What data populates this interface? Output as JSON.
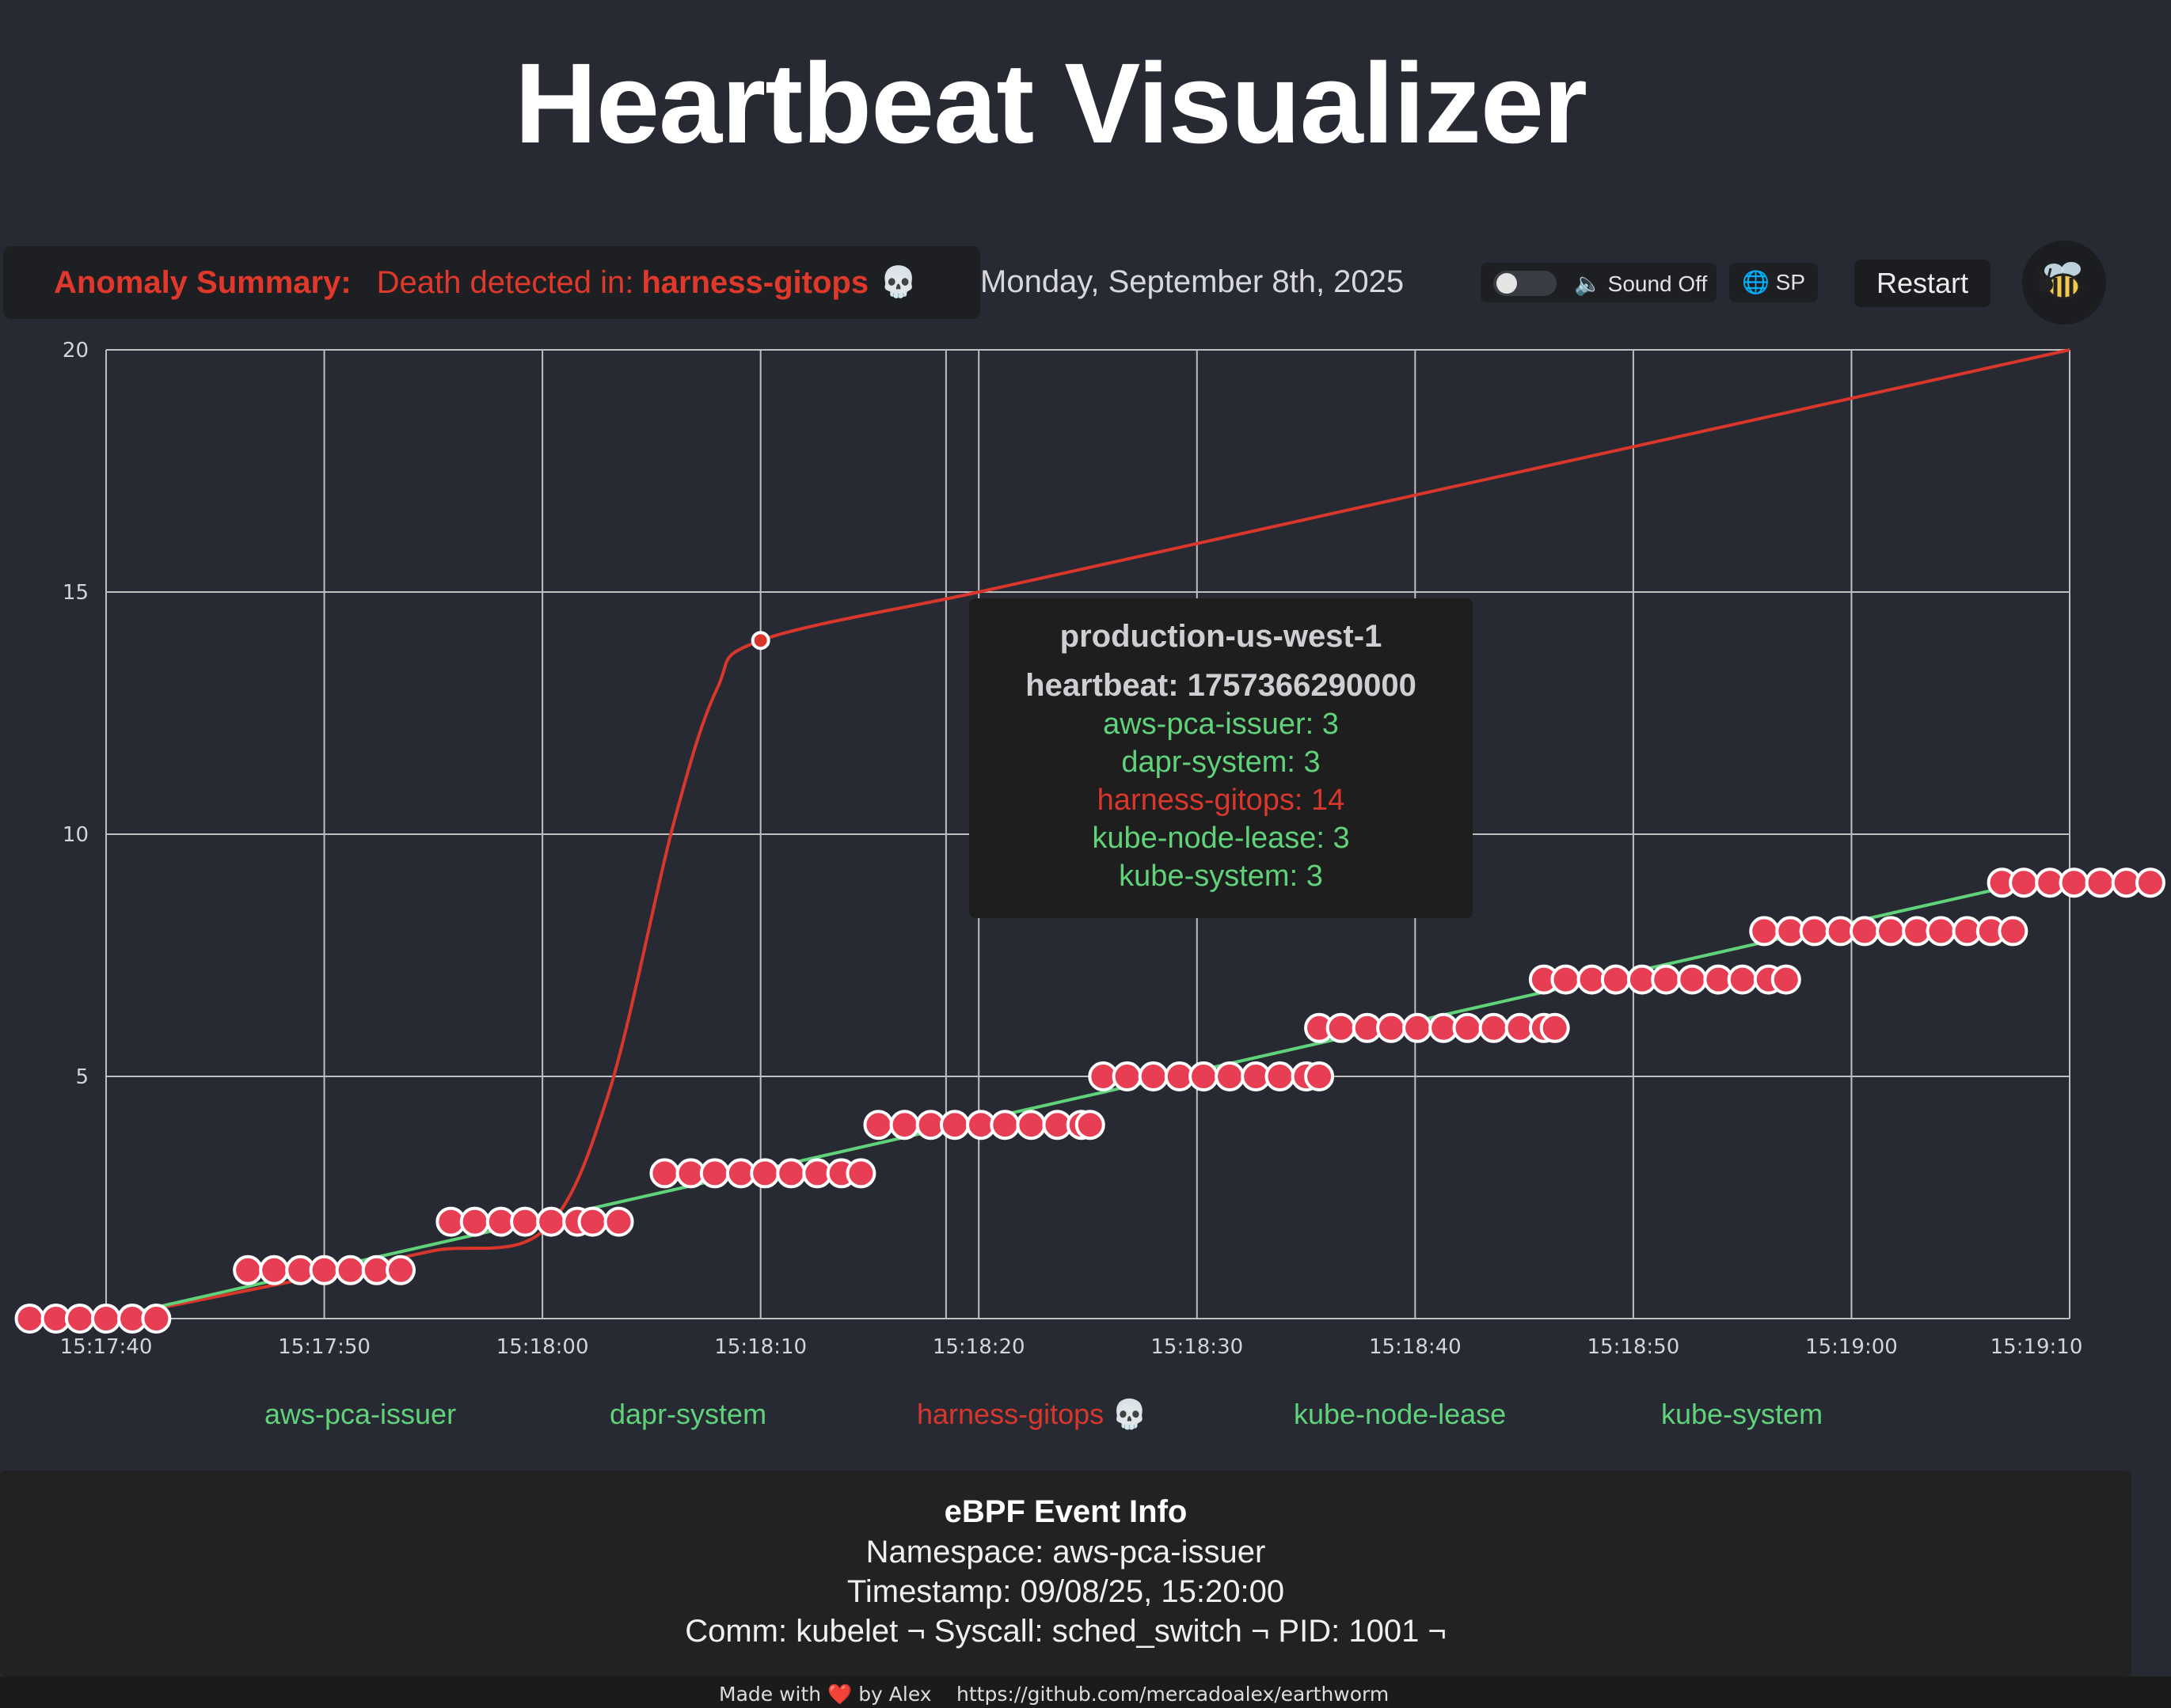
{
  "header": {
    "title": "Heartbeat Visualizer"
  },
  "anomaly": {
    "label": "Anomaly Summary:",
    "message": "Death detected in:",
    "namespace": "harness-gitops",
    "icon": "skull-icon",
    "skull_glyph": "💀"
  },
  "date": "Monday, September 8th, 2025",
  "controls": {
    "sound_label": "🔈 Sound Off",
    "sound_on": false,
    "language_label": "🌐 SP",
    "restart_label": "Restart",
    "mascot_icon": "bee-icon"
  },
  "colors": {
    "healthy": "#5fd27a",
    "dead": "#d9372c",
    "point_fill": "#e83e53",
    "grid": "#bfbfbf"
  },
  "chart_data": {
    "type": "line",
    "x_ticks": [
      "15:17:40",
      "15:17:50",
      "15:18:00",
      "15:18:10",
      "15:18:20",
      "15:18:30",
      "15:18:40",
      "15:18:50",
      "15:19:00",
      "15:19:10"
    ],
    "y_ticks": [
      "20",
      "15",
      "10",
      "5"
    ],
    "ylim": [
      0,
      20
    ],
    "grid": true,
    "series": [
      {
        "name": "harness-gitops",
        "status": "dead",
        "points": [
          [
            "15:17:40",
            0
          ],
          [
            "15:17:50",
            0.9
          ],
          [
            "15:17:55",
            1.4
          ],
          [
            "15:18:00",
            1.8
          ],
          [
            "15:18:03",
            4.6
          ],
          [
            "15:18:06",
            10.2
          ],
          [
            "15:18:08",
            13.0
          ],
          [
            "15:18:10",
            14.0
          ],
          [
            "15:18:20",
            15.0
          ],
          [
            "15:18:30",
            16.0
          ],
          [
            "15:18:40",
            17.0
          ],
          [
            "15:18:50",
            18.0
          ],
          [
            "15:19:00",
            19.0
          ],
          [
            "15:19:10",
            20.0
          ]
        ],
        "highlight": [
          "15:18:10",
          14
        ]
      },
      {
        "name": "aws-pca-issuer",
        "status": "healthy",
        "points": [
          [
            "15:17:40",
            0
          ],
          [
            "15:19:08",
            9
          ]
        ]
      }
    ],
    "heartbeat_points": {
      "series": [
        "aws-pca-issuer",
        "dapr-system",
        "kube-node-lease",
        "kube-system"
      ],
      "levels": [
        {
          "value": 0,
          "times": [
            "15:17:36.5",
            "15:17:37.7",
            "15:17:38.8",
            "15:17:40.0",
            "15:17:41.2",
            "15:17:42.3"
          ]
        },
        {
          "value": 1,
          "times": [
            "15:17:46.5",
            "15:17:47.7",
            "15:17:48.9",
            "15:17:50.0",
            "15:17:51.2",
            "15:17:52.4",
            "15:17:53.5"
          ]
        },
        {
          "value": 2,
          "times": [
            "15:17:55.8",
            "15:17:56.9",
            "15:17:58.1",
            "15:17:59.2",
            "15:18:00.4",
            "15:18:01.6",
            "15:18:02.3",
            "15:18:03.5"
          ]
        },
        {
          "value": 3,
          "times": [
            "15:18:05.6",
            "15:18:06.8",
            "15:18:07.9",
            "15:18:09.1",
            "15:18:10.2",
            "15:18:11.4",
            "15:18:12.6",
            "15:18:13.7",
            "15:18:14.6"
          ]
        },
        {
          "value": 4,
          "times": [
            "15:18:15.4",
            "15:18:16.6",
            "15:18:17.8",
            "15:18:18.9",
            "15:18:20.1",
            "15:18:21.2",
            "15:18:22.4",
            "15:18:23.6",
            "15:18:24.7",
            "15:18:25.1"
          ]
        },
        {
          "value": 5,
          "times": [
            "15:18:25.7",
            "15:18:26.8",
            "15:18:28.0",
            "15:18:29.2",
            "15:18:30.3",
            "15:18:31.5",
            "15:18:32.7",
            "15:18:33.8",
            "15:18:35.0",
            "15:18:35.6"
          ]
        },
        {
          "value": 6,
          "times": [
            "15:18:35.6",
            "15:18:36.6",
            "15:18:37.8",
            "15:18:38.9",
            "15:18:40.1",
            "15:18:41.3",
            "15:18:42.4",
            "15:18:43.6",
            "15:18:44.8",
            "15:18:45.9",
            "15:18:46.4"
          ]
        },
        {
          "value": 7,
          "times": [
            "15:18:45.9",
            "15:18:46.9",
            "15:18:48.1",
            "15:18:49.2",
            "15:18:50.4",
            "15:18:51.5",
            "15:18:52.7",
            "15:18:53.9",
            "15:18:55.0",
            "15:18:56.2",
            "15:18:57.0"
          ]
        },
        {
          "value": 8,
          "times": [
            "15:18:56.0",
            "15:18:57.2",
            "15:18:58.3",
            "15:18:59.5",
            "15:19:00.6",
            "15:19:01.8",
            "15:19:03.0",
            "15:19:04.1",
            "15:19:05.3",
            "15:19:06.4",
            "15:19:07.4"
          ]
        },
        {
          "value": 9,
          "times": [
            "15:19:06.9",
            "15:19:07.9",
            "15:19:09.1",
            "15:19:10.2",
            "15:19:11.4",
            "15:19:12.6",
            "15:19:13.7"
          ]
        }
      ]
    }
  },
  "tooltip": {
    "title": "production-us-west-1",
    "heartbeat": "heartbeat: 1757366290000",
    "rows": [
      {
        "label": "aws-pca-issuer: 3",
        "status": "healthy"
      },
      {
        "label": "dapr-system: 3",
        "status": "healthy"
      },
      {
        "label": "harness-gitops: 14",
        "status": "dead"
      },
      {
        "label": "kube-node-lease: 3",
        "status": "healthy"
      },
      {
        "label": "kube-system: 3",
        "status": "healthy"
      }
    ]
  },
  "legend": [
    {
      "label": "aws-pca-issuer",
      "status": "healthy"
    },
    {
      "label": "dapr-system",
      "status": "healthy"
    },
    {
      "label": "harness-gitops 💀",
      "status": "dead"
    },
    {
      "label": "kube-node-lease",
      "status": "healthy"
    },
    {
      "label": "kube-system",
      "status": "healthy"
    }
  ],
  "event_info": {
    "title": "eBPF Event Info",
    "namespace": "Namespace: aws-pca-issuer",
    "timestamp": "Timestamp: 09/08/25, 15:20:00",
    "details": "Comm: kubelet ¬ Syscall: sched_switch ¬ PID: 1001 ¬"
  },
  "footer": {
    "made_with_prefix": "Made with",
    "heart_glyph": "❤️",
    "made_with_suffix": "by Alex",
    "link": "https://github.com/mercadoalex/earthworm"
  }
}
